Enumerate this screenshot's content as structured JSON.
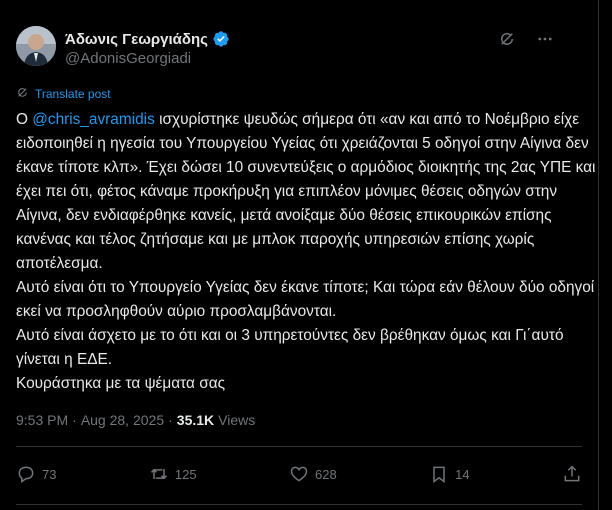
{
  "author": {
    "display_name": "Άδωνις Γεωργιάδης",
    "handle": "@AdonisGeorgiadi",
    "verified": true
  },
  "translate_label": "Translate post",
  "tweet": {
    "paragraphs": [
      {
        "prefix": "Ο ",
        "mention": "@chris_avramidis",
        "text": " ισχυρίστηκε ψευδώς σήμερα ότι «αν και από το Νοέμβριο είχε ειδοποιηθεί η ηγεσία του Υπουργείου Υγείας ότι χρειάζονται 5 οδηγοί στην Αίγινα δεν έκανε τίποτε κλπ». Έχει δώσει 10 συνεντεύξεις ο αρμόδιος διοικητής της 2ας ΥΠΕ και έχει πει ότι, φέτος κάναμε προκήρυξη για επιπλέον μόνιμες θέσεις οδηγών στην Αίγινα, δεν ενδιαφέρθηκε κανείς, μετά ανοίξαμε δύο θέσεις επικουρικών επίσης κανένας και τέλος ζητήσαμε και με μπλοκ παροχής υπηρεσιών επίσης χωρίς αποτέλεσμα."
      },
      {
        "text": "Αυτό είναι ότι το Υπουργείο Υγείας δεν έκανε τίποτε; Και τώρα εάν θέλουν δύο οδηγοί εκεί να προσληφθούν αύριο προσλαμβάνονται."
      },
      {
        "text": "Αυτό είναι άσχετο με το ότι και οι 3 υπηρετούντες δεν βρέθηκαν όμως και Γι΄αυτό γίνεται η ΕΔΕ."
      },
      {
        "text": "Κουράστηκα με τα ψέματα σας"
      }
    ]
  },
  "meta": {
    "time": "9:53 PM",
    "separator": "·",
    "date": "Aug 28, 2025",
    "views_count": "35.1K",
    "views_label": "Views"
  },
  "actions": {
    "replies": "73",
    "reposts": "125",
    "likes": "628",
    "bookmarks": "14"
  },
  "colors": {
    "accent": "#1d9bf0",
    "background": "#000000",
    "text": "#e7e9ea",
    "muted": "#71767b"
  }
}
